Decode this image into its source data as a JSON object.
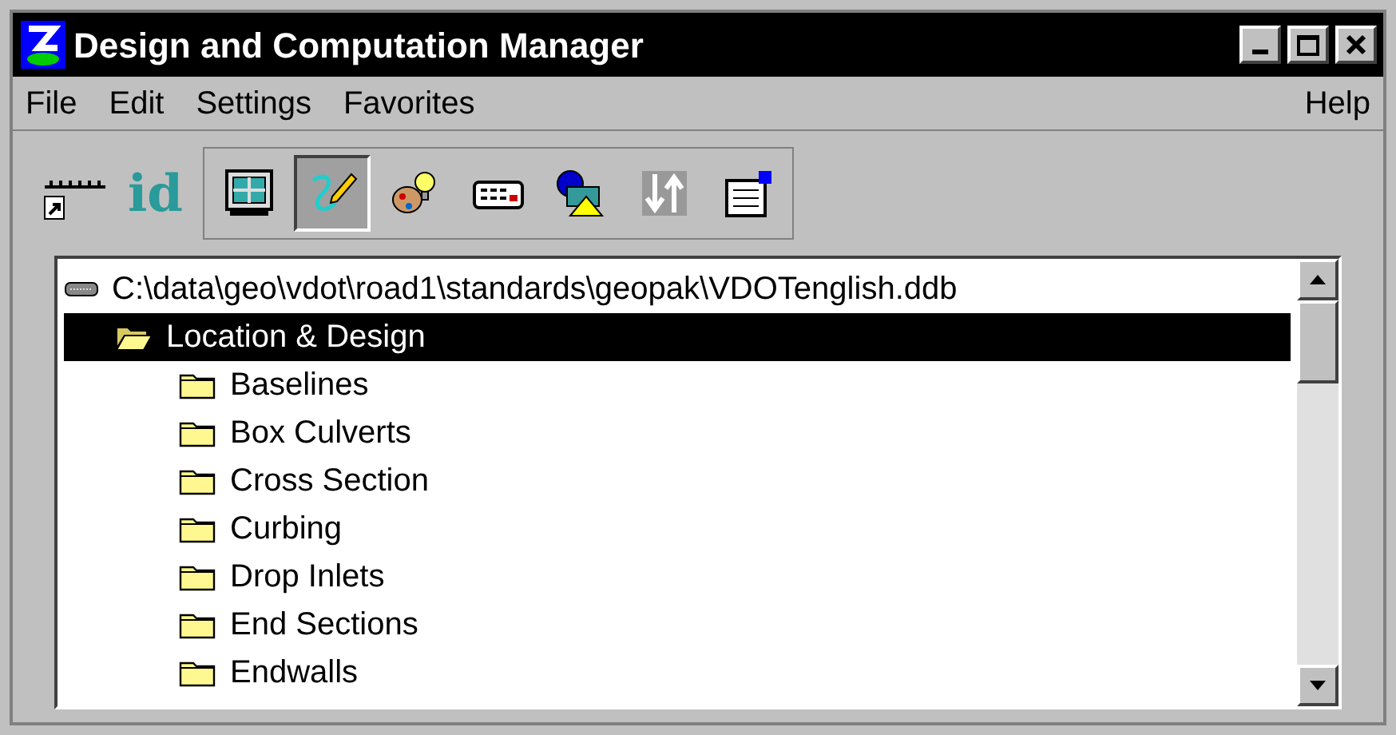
{
  "window": {
    "title": "Design and Computation Manager"
  },
  "menu": [
    {
      "label": "File"
    },
    {
      "label": "Edit"
    },
    {
      "label": "Settings"
    },
    {
      "label": "Favorites"
    },
    {
      "label": "Help"
    }
  ],
  "toolbar": {
    "id_label": "id",
    "tools": [
      {
        "kind": "panel",
        "selected": false
      },
      {
        "kind": "draw",
        "selected": true
      },
      {
        "kind": "palette",
        "selected": false
      },
      {
        "kind": "keypad",
        "selected": false
      },
      {
        "kind": "shapes",
        "selected": false
      },
      {
        "kind": "arrows",
        "selected": false
      },
      {
        "kind": "clipboard",
        "selected": false
      }
    ]
  },
  "tree": {
    "root": {
      "label": "C:\\data\\geo\\vdot\\road1\\standards\\geopak\\VDOTenglish.ddb",
      "children": [
        {
          "label": "Location & Design",
          "expanded": true,
          "selected": true,
          "children": [
            {
              "label": "Baselines",
              "selected": false
            },
            {
              "label": "Box Culverts",
              "selected": false
            },
            {
              "label": "Cross Section",
              "selected": false
            },
            {
              "label": "Curbing",
              "selected": false
            },
            {
              "label": "Drop Inlets",
              "selected": false
            },
            {
              "label": "End Sections",
              "selected": false
            },
            {
              "label": "Endwalls",
              "selected": false
            }
          ]
        }
      ]
    }
  }
}
